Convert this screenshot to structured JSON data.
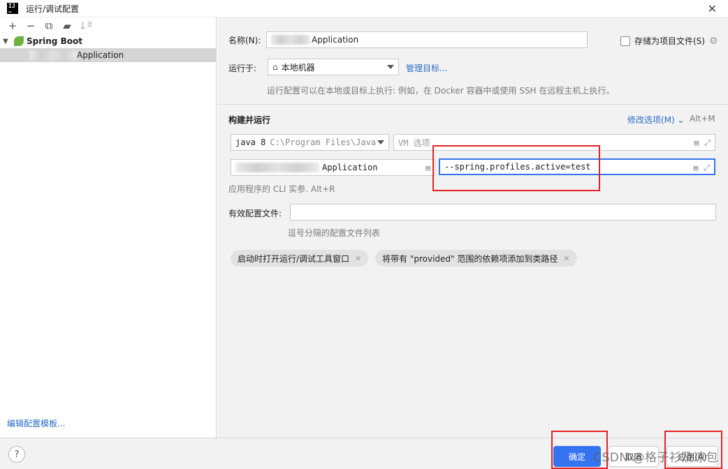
{
  "window": {
    "title": "运行/调试配置",
    "close": "✕"
  },
  "left_toolbar": {
    "add": "+",
    "remove": "−",
    "copy": "⧉",
    "folder": "▰",
    "sort": "↓ª"
  },
  "tree": {
    "group_label": "Spring Boot",
    "item_label": "Application"
  },
  "edit_templates": "编辑配置模板...",
  "form": {
    "name_label": "名称(N):",
    "name_value": "Application",
    "store_label": "存储为项目文件(S)",
    "run_on_label": "运行于:",
    "run_on_value": "本地机器",
    "manage_targets": "管理目标...",
    "run_hint": "运行配置可以在本地或目标上执行: 例如，在 Docker 容器中或使用 SSH 在远程主机上执行。",
    "build_run_label": "构建并运行",
    "modify_options": "修改选项(M)",
    "modify_shortcut": "Alt+M",
    "jdk_version": "java 8",
    "jdk_path": "C:\\Program Files\\Java",
    "vm_placeholder": "VM 选项",
    "main_class": "Application",
    "program_args": "--spring.profiles.active=test",
    "cli_hint": "应用程序的 CLI 实参. Alt+R",
    "profiles_label": "有效配置文件:",
    "profiles_value": "",
    "profiles_hint": "逗号分隔的配置文件列表",
    "tag1": "启动时打开运行/调试工具窗口",
    "tag2": "将带有 \"provided\" 范围的依赖项添加到类路径"
  },
  "footer": {
    "help": "?",
    "ok": "确定",
    "cancel": "取消",
    "apply": "应用(A)"
  },
  "watermark": "CSDN @格子衫及凉包",
  "colors": {
    "accent": "#3574f0",
    "highlight": "#e62222",
    "spring_green": "#6db33f"
  }
}
